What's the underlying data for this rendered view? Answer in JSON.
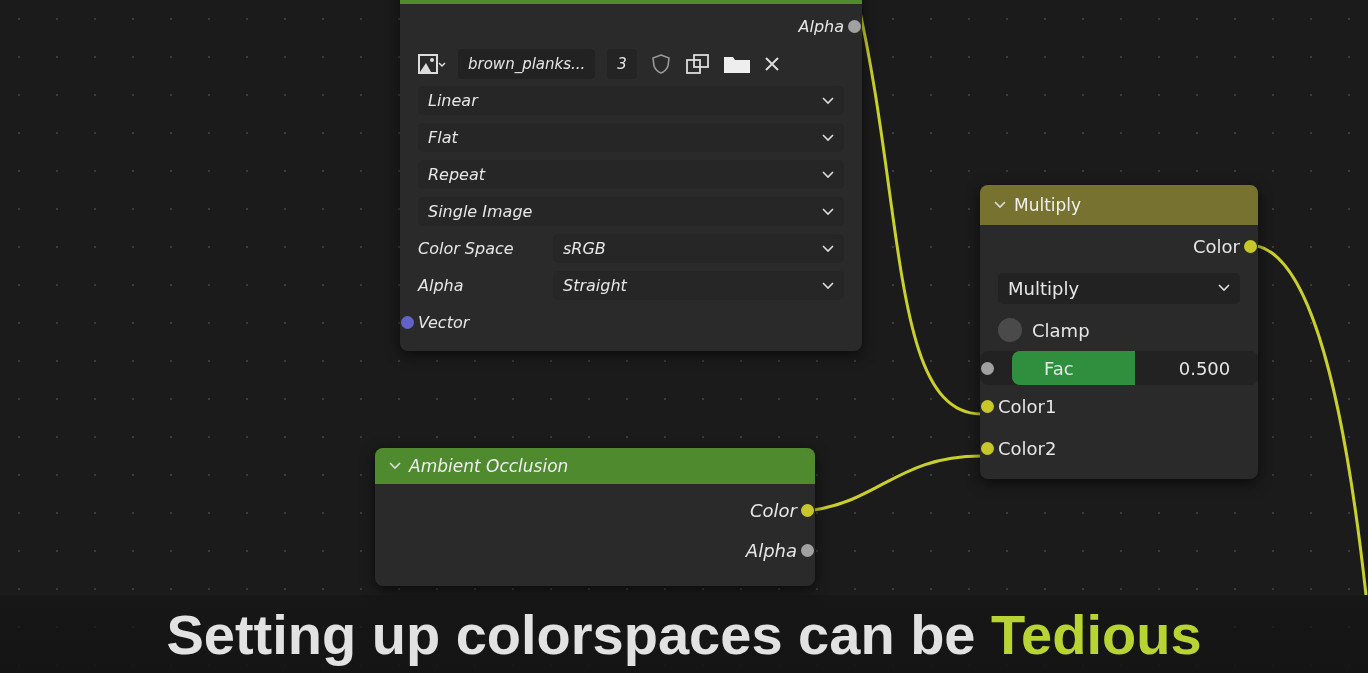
{
  "nodes": [
    {
      "color": "#4f8a2e",
      "rows": [
        {
          "kind": "output",
          "label": "Alpha",
          "color": "#a1a1a1"
        },
        {
          "kind": "image",
          "name": "brown_planks...",
          "users": "3"
        },
        {
          "kind": "dropdown",
          "value": "Linear"
        },
        {
          "kind": "dropdown",
          "value": "Flat"
        },
        {
          "kind": "dropdown",
          "value": "Repeat"
        },
        {
          "kind": "dropdown",
          "value": "Single Image"
        },
        {
          "kind": "dropdown",
          "label": "Color Space",
          "value": "sRGB"
        },
        {
          "kind": "dropdown",
          "label": "Alpha",
          "value": "Straight"
        },
        {
          "kind": "input",
          "label": "Vector",
          "color": "#6363c7"
        }
      ]
    },
    {
      "title": "Multiply",
      "color": "#77722f",
      "rows": [
        {
          "kind": "output",
          "label": "Color",
          "color": "#c7c729"
        },
        {
          "kind": "dropdown",
          "value": "Multiply"
        },
        {
          "kind": "checkbox",
          "label": "Clamp",
          "checked": false
        },
        {
          "kind": "slider",
          "label": "Fac",
          "value": "0.500",
          "level": 0.5,
          "color": "#a1a1a1"
        },
        {
          "kind": "input",
          "label": "Color1",
          "color": "#c7c729"
        },
        {
          "kind": "input",
          "label": "Color2",
          "color": "#c7c729"
        }
      ]
    },
    {
      "title": "Ambient Occlusion",
      "color": "#4f8a2e",
      "rows": [
        {
          "kind": "output",
          "label": "Color",
          "color": "#c7c729"
        },
        {
          "kind": "output",
          "label": "Alpha",
          "color": "#a1a1a1"
        }
      ]
    }
  ],
  "caption": [
    {
      "text": "Setting up colorspaces can be ",
      "highlight": false
    },
    {
      "text": "Tedious",
      "highlight": true
    }
  ]
}
